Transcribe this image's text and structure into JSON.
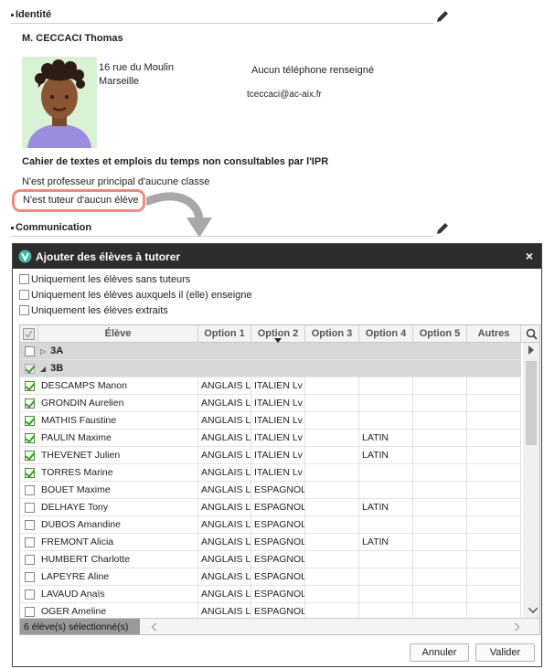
{
  "identity": {
    "section_title": "Identité",
    "name": "M. CECCACI Thomas",
    "address_line1": "16 rue du Moulin",
    "address_line2": "Marseille",
    "phone": "Aucun téléphone renseigné",
    "email": "tceccaci@ac-aix.fr",
    "cahier_notice": "Cahier de textes et emplois du temps non consultables par l'IPR",
    "prof_principal": "N'est professeur principal d'aucune classe",
    "tuteur": "N'est tuteur d'aucun élève"
  },
  "communication": {
    "section_title": "Communication"
  },
  "dialog": {
    "title": "Ajouter des élèves à tutorer",
    "close": "×",
    "options": [
      "Uniquement les élèves sans tuteurs",
      "Uniquement les élèves auxquels il (elle) enseigne",
      "Uniquement les élèves extraits"
    ],
    "columns": [
      "Élève",
      "Option 1",
      "Option 2",
      "Option 3",
      "Option 4",
      "Option 5",
      "Autres"
    ],
    "groups": [
      {
        "label": "3A",
        "expanded": false
      },
      {
        "label": "3B",
        "expanded": true
      }
    ],
    "students": [
      {
        "name": "DESCAMPS Manon",
        "checked": true,
        "opt1": "ANGLAIS L",
        "opt2": "ITALIEN Lv",
        "opt4": ""
      },
      {
        "name": "GRONDIN Aurelien",
        "checked": true,
        "opt1": "ANGLAIS L",
        "opt2": "ITALIEN Lv",
        "opt4": ""
      },
      {
        "name": "MATHIS Faustine",
        "checked": true,
        "opt1": "ANGLAIS L",
        "opt2": "ITALIEN Lv",
        "opt4": ""
      },
      {
        "name": "PAULIN Maxime",
        "checked": true,
        "opt1": "ANGLAIS L",
        "opt2": "ITALIEN Lv",
        "opt4": "LATIN"
      },
      {
        "name": "THEVENET Julien",
        "checked": true,
        "opt1": "ANGLAIS L",
        "opt2": "ITALIEN Lv",
        "opt4": "LATIN"
      },
      {
        "name": "TORRES Marine",
        "checked": true,
        "opt1": "ANGLAIS L",
        "opt2": "ITALIEN Lv",
        "opt4": ""
      },
      {
        "name": "BOUET Maxime",
        "checked": false,
        "opt1": "ANGLAIS L",
        "opt2": "ESPAGNOL",
        "opt4": ""
      },
      {
        "name": "DELHAYE Tony",
        "checked": false,
        "opt1": "ANGLAIS L",
        "opt2": "ESPAGNOL",
        "opt4": "LATIN"
      },
      {
        "name": "DUBOS Amandine",
        "checked": false,
        "opt1": "ANGLAIS L",
        "opt2": "ESPAGNOL",
        "opt4": ""
      },
      {
        "name": "FREMONT Alicia",
        "checked": false,
        "opt1": "ANGLAIS L",
        "opt2": "ESPAGNOL",
        "opt4": "LATIN"
      },
      {
        "name": "HUMBERT Charlotte",
        "checked": false,
        "opt1": "ANGLAIS L",
        "opt2": "ESPAGNOL",
        "opt4": ""
      },
      {
        "name": "LAPEYRE Aline",
        "checked": false,
        "opt1": "ANGLAIS L",
        "opt2": "ESPAGNOL",
        "opt4": ""
      },
      {
        "name": "LAVAUD Anaïs",
        "checked": false,
        "opt1": "ANGLAIS L",
        "opt2": "ESPAGNOL",
        "opt4": ""
      },
      {
        "name": "OGER Ameline",
        "checked": false,
        "opt1": "ANGLAIS L",
        "opt2": "ESPAGNOL",
        "opt4": ""
      }
    ],
    "selection_count": "6 élève(s) sélectionné(s)",
    "cancel": "Annuler",
    "validate": "Valider"
  }
}
